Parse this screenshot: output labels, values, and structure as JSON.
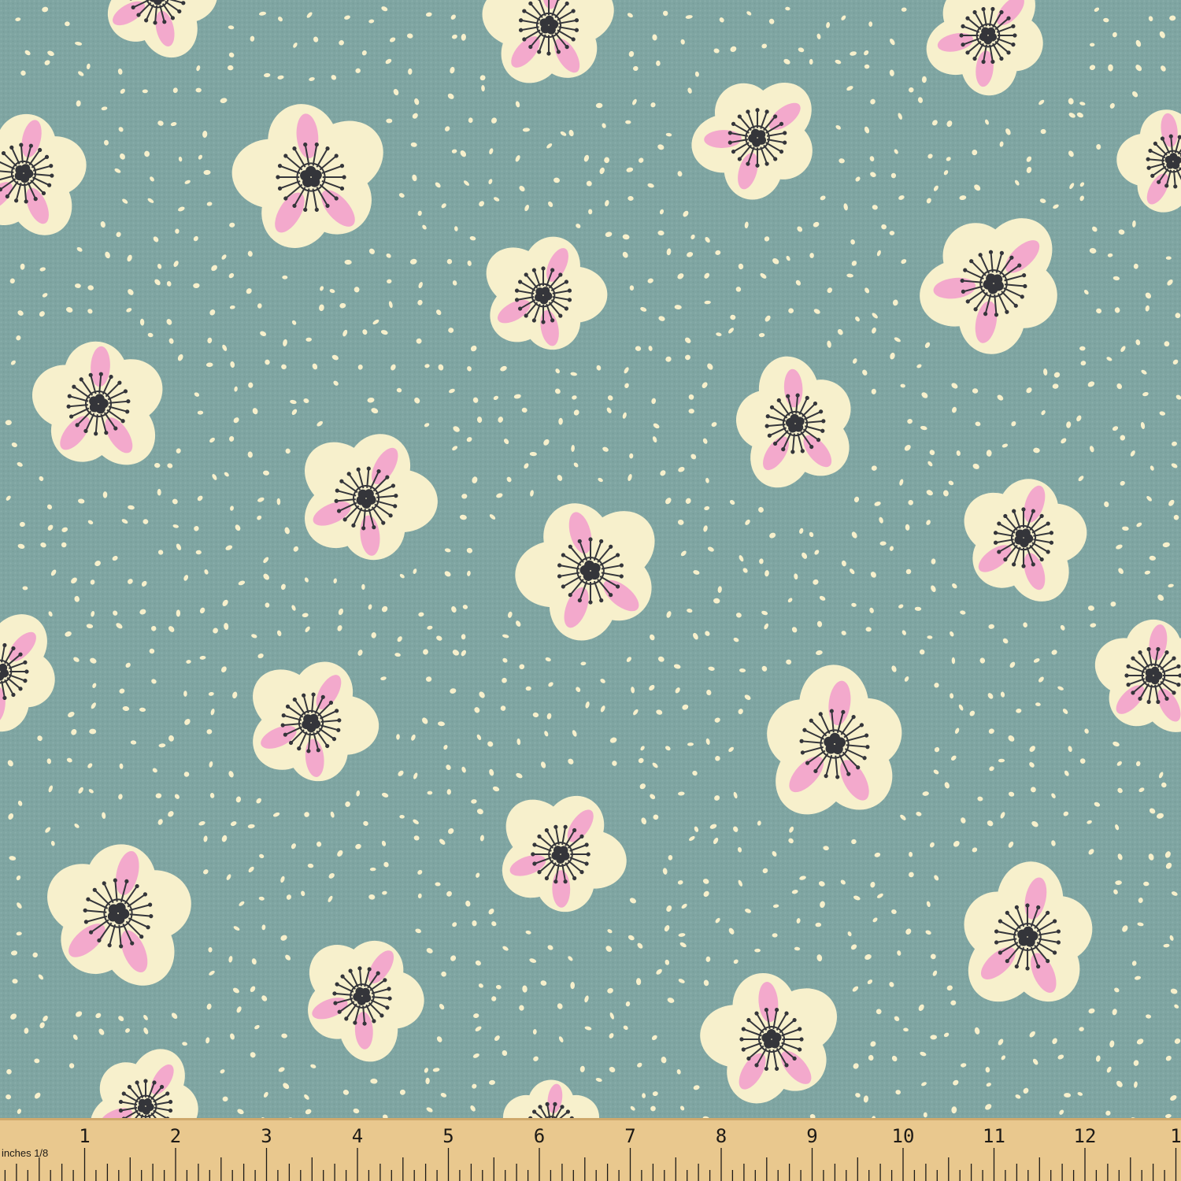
{
  "colors": {
    "fabric_background": "#7fa5a2",
    "weave_highlight": "#8db1ae",
    "weave_shadow": "#6f9592",
    "petal": "#f7f0cc",
    "petal_accent": "#f3a9cc",
    "stamen": "#34353a",
    "ruler_wood": "#e9c88e",
    "ruler_ink": "#1d1a16"
  },
  "icons": {
    "flower": "cream-five-petal-flower-icon",
    "dot": "cream-dot"
  },
  "ruler": {
    "unit_label": "inches 1/8",
    "numbers": [
      "1",
      "2",
      "3",
      "4",
      "5",
      "6",
      "7",
      "8",
      "9",
      "10",
      "11",
      "12",
      "1"
    ]
  }
}
